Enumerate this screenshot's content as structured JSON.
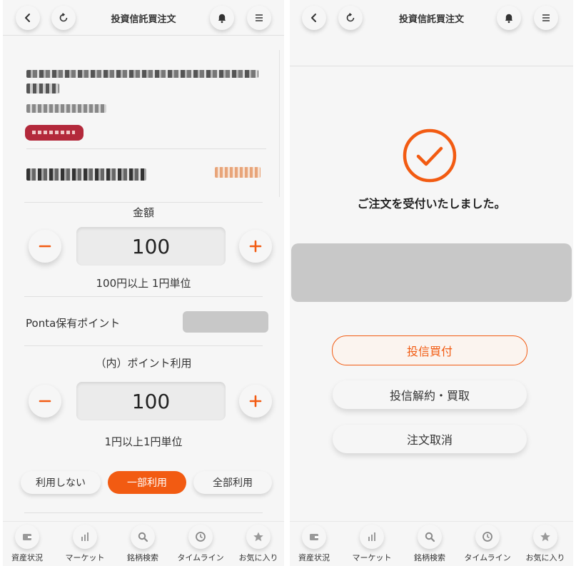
{
  "header": {
    "title": "投資信託買注文"
  },
  "colors": {
    "accent": "#f25b12",
    "tag": "#c0392b"
  },
  "icons": {
    "back": "chevron-left-icon",
    "refresh": "refresh-icon",
    "bell": "bell-icon",
    "menu": "hamburger-menu-icon",
    "minus": "minus-icon",
    "plus": "plus-icon",
    "check": "check-circle-icon"
  },
  "order_form": {
    "amount": {
      "label": "金額",
      "value": "100",
      "hint": "100円以上 1円単位"
    },
    "ponta": {
      "label": "Ponta保有ポイント"
    },
    "point_use": {
      "label": "（内）ポイント利用",
      "value": "100",
      "hint": "1円以上1円単位",
      "options": [
        "利用しない",
        "一部利用",
        "全部利用"
      ],
      "selected": "一部利用"
    }
  },
  "confirmation": {
    "message": "ご注文を受付いたしました。",
    "buttons": {
      "buy": "投信買付",
      "sell": "投信解約・買取",
      "cancel": "注文取消"
    }
  },
  "bottom_nav": [
    {
      "label": "資産状況",
      "icon": "wallet-icon"
    },
    {
      "label": "マーケット",
      "icon": "bar-chart-icon"
    },
    {
      "label": "銘柄検索",
      "icon": "search-icon"
    },
    {
      "label": "タイムライン",
      "icon": "clock-icon"
    },
    {
      "label": "お気に入り",
      "icon": "star-icon"
    }
  ]
}
